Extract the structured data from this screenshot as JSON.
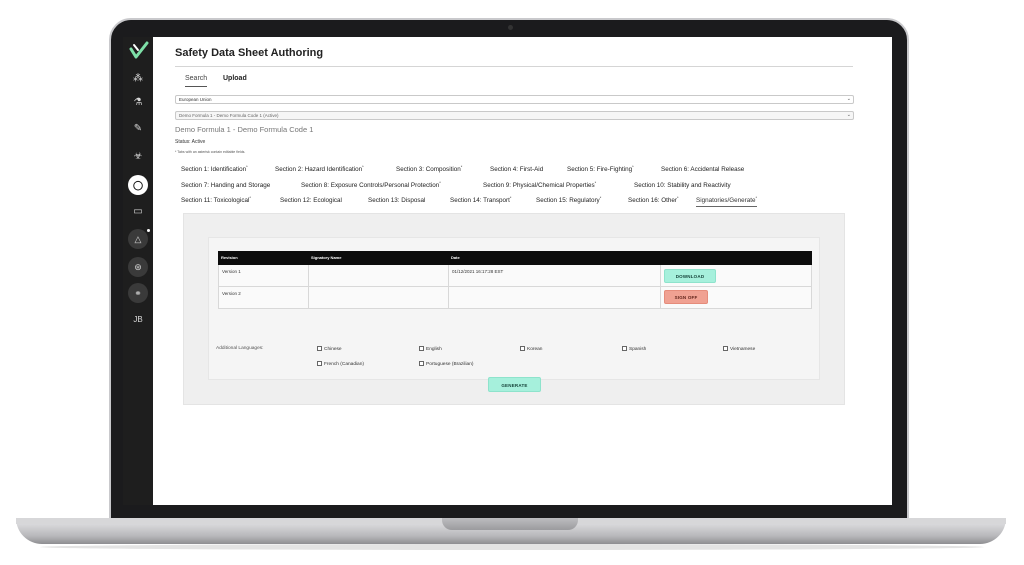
{
  "app": {
    "title": "Safety Data Sheet Authoring",
    "tabs": [
      "Search",
      "Upload"
    ]
  },
  "sidebar": {
    "icons": [
      "logo-icon",
      "network-icon",
      "flask-icon",
      "pencil-icon",
      "biohazard-icon",
      "chat-icon",
      "folder-icon",
      "bell-icon",
      "chemistry-icon",
      "molecule-icon",
      "user-initials"
    ],
    "user_initials": "JB"
  },
  "filters": {
    "region": "European Union",
    "formula": "Demo Formula 1 - Demo Formula Code 1 (Active)"
  },
  "formula": {
    "title": "Demo Formula 1 - Demo Formula Code 1",
    "status": "Status: Active",
    "note": "* Tabs with an asterisk contain editable fields."
  },
  "sections": {
    "row1": [
      {
        "label": "Section 1: Identification",
        "star": "*"
      },
      {
        "label": "Section 2: Hazard Identification",
        "star": "*"
      },
      {
        "label": "Section 3: Composition",
        "star": "*"
      },
      {
        "label": "Section 4: First-Aid",
        "star": ""
      },
      {
        "label": "Section 5: Fire-Fighting",
        "star": "*"
      },
      {
        "label": "Section 6: Accidental Release",
        "star": ""
      }
    ],
    "row2": [
      {
        "label": "Section 7: Handing and Storage",
        "star": ""
      },
      {
        "label": "Section 8: Exposure Controls/Personal Protection",
        "star": "*"
      },
      {
        "label": "Section 9: Physical/Chemical Properties",
        "star": "*"
      },
      {
        "label": "Section 10: Stability and Reactivity",
        "star": ""
      }
    ],
    "row3": [
      {
        "label": "Section 11: Toxicological",
        "star": "*"
      },
      {
        "label": "Section 12: Ecological",
        "star": ""
      },
      {
        "label": "Section 13: Disposal",
        "star": ""
      },
      {
        "label": "Section 14: Transport",
        "star": "*"
      },
      {
        "label": "Section 15: Regulatory",
        "star": "*"
      },
      {
        "label": "Section 16: Other",
        "star": "*"
      },
      {
        "label": "Signatories/Generate",
        "star": "*"
      }
    ]
  },
  "signatories": {
    "columns": [
      "Revision",
      "Signatory Name",
      "Date",
      ""
    ],
    "rows": [
      {
        "revision": "Version 1",
        "signatory": "",
        "date": "01/12/2021 16:17:28 EST",
        "action": "DOWNLOAD"
      },
      {
        "revision": "Version 2",
        "signatory": "",
        "date": "",
        "action": "SIGN OFF"
      }
    ]
  },
  "languages": {
    "label": "Additional Languages:",
    "options": [
      "Chinese",
      "English",
      "Korean",
      "Spanish",
      "Vietnamese",
      "French (Canadian)",
      "Portuguese (Brazilian)"
    ]
  },
  "generate_label": "GENERATE",
  "colors": {
    "sidebar": "#1e1e1e",
    "teal_button": "#a6f0dc",
    "salmon_button": "#f0a192",
    "table_header": "#0c0c0c"
  }
}
